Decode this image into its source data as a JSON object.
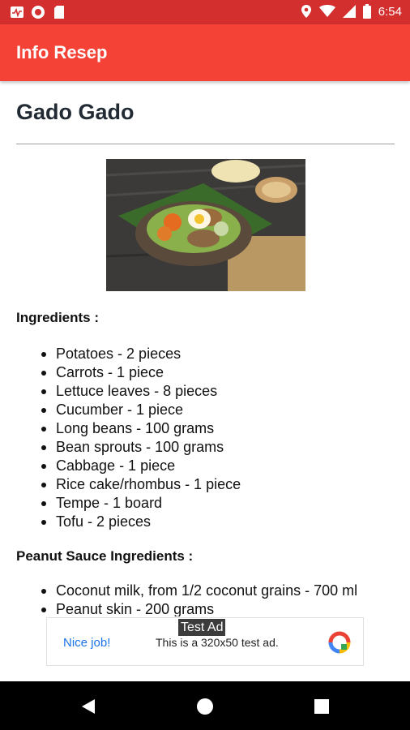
{
  "status_bar": {
    "time": "6:54",
    "left_icons": [
      "activity-icon",
      "record-icon",
      "sd-card-icon"
    ],
    "right_icons": [
      "location-icon",
      "wifi-icon",
      "signal-icon",
      "battery-icon"
    ]
  },
  "app_bar": {
    "title": "Info Resep",
    "color": "#f44336"
  },
  "recipe": {
    "title": "Gado Gado",
    "ingredients_title": "Ingredients :",
    "ingredients": [
      "Potatoes - 2 pieces",
      "Carrots - 1 piece",
      "Lettuce leaves - 8 pieces",
      "Cucumber - 1 piece",
      "Long beans - 100 grams",
      "Bean sprouts - 100 grams",
      "Cabbage - 1 piece",
      "Rice cake/rhombus - 1 piece",
      "Tempe - 1 board",
      "Tofu - 2 pieces"
    ],
    "sauce_title": "Peanut Sauce Ingredients :",
    "sauce_ingredients": [
      "Coconut milk, from 1/2 coconut grains - 700 ml",
      "Peanut skin - 200 grams"
    ]
  },
  "ad": {
    "tag": "Test Ad",
    "nice": "Nice job!",
    "text": "This is a 320x50 test ad."
  },
  "nav_bar": {
    "icons": [
      "back-icon",
      "home-icon",
      "recents-icon"
    ]
  },
  "colors": {
    "status_bar": "#d32f2f",
    "accent": "#f44336",
    "ad_link": "#1a73e8"
  }
}
